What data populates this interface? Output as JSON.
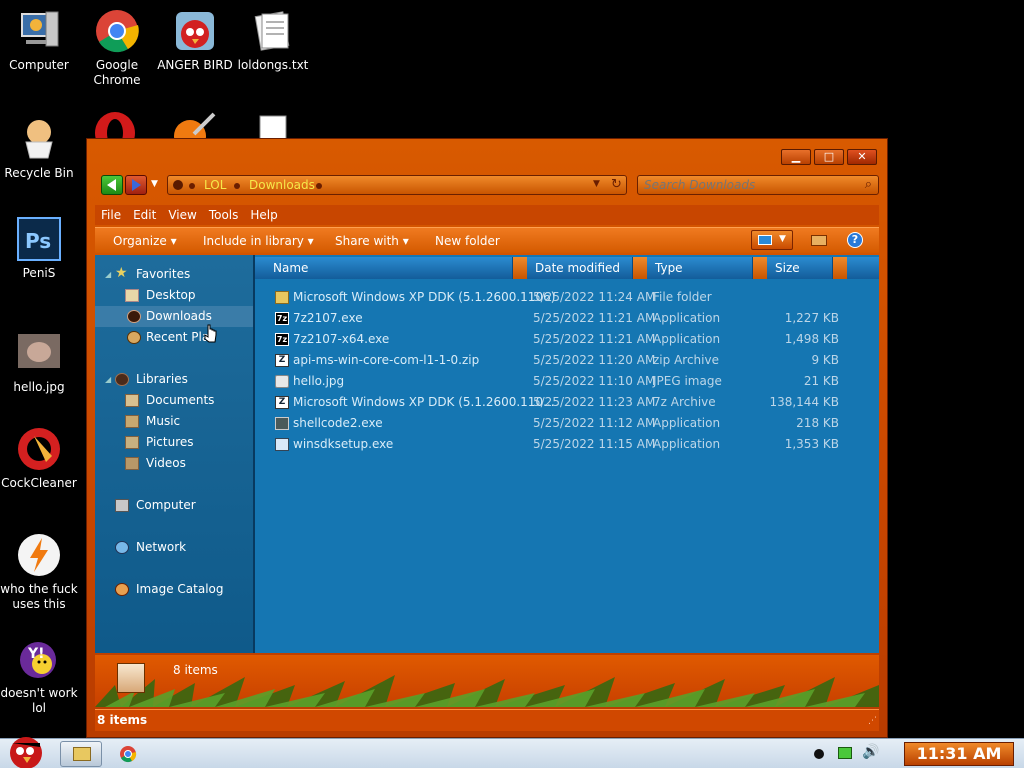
{
  "desktop": {
    "icons": [
      {
        "label": "Computer",
        "icon": "computer-icon"
      },
      {
        "label": "Google Chrome",
        "icon": "chrome-icon"
      },
      {
        "label": "ANGER BIRD",
        "icon": "angry-bird-icon"
      },
      {
        "label": "loldongs.txt",
        "icon": "text-file-icon"
      },
      {
        "label": "Recycle Bin",
        "icon": "recycle-bin-icon"
      },
      {
        "label": "PeniS",
        "icon": "photoshop-icon"
      },
      {
        "label": "hello.jpg",
        "icon": "image-file-icon"
      },
      {
        "label": "CockCleaner",
        "icon": "ccleaner-icon"
      },
      {
        "label": "who the fuck uses this",
        "icon": "winamp-icon"
      },
      {
        "label": "doesn't work lol",
        "icon": "yahoo-messenger-icon"
      }
    ]
  },
  "window": {
    "address": {
      "crumbs": [
        "LOL",
        "Downloads"
      ]
    },
    "search": {
      "placeholder": "Search Downloads"
    },
    "menubar": [
      "File",
      "Edit",
      "View",
      "Tools",
      "Help"
    ],
    "commands": {
      "organize": "Organize",
      "include": "Include in library",
      "share": "Share with",
      "new_folder": "New folder"
    },
    "nav": {
      "favorites": "Favorites",
      "desktop": "Desktop",
      "downloads": "Downloads",
      "recent": "Recent Pla",
      "libraries": "Libraries",
      "documents": "Documents",
      "music": "Music",
      "pictures": "Pictures",
      "videos": "Videos",
      "computer": "Computer",
      "network": "Network",
      "image_catalog": "Image Catalog"
    },
    "columns": {
      "name": "Name",
      "date": "Date modified",
      "type": "Type",
      "size": "Size"
    },
    "files": [
      {
        "name": "Microsoft Windows XP DDK (5.1.2600.1106)",
        "date": "5/25/2022 11:24 AM",
        "type": "File folder",
        "size": "",
        "icon": "folder-icon"
      },
      {
        "name": "7z2107.exe",
        "date": "5/25/2022 11:21 AM",
        "type": "Application",
        "size": "1,227 KB",
        "icon": "7zip-icon"
      },
      {
        "name": "7z2107-x64.exe",
        "date": "5/25/2022 11:21 AM",
        "type": "Application",
        "size": "1,498 KB",
        "icon": "7zip-icon"
      },
      {
        "name": "api-ms-win-core-com-l1-1-0.zip",
        "date": "5/25/2022 11:20 AM",
        "type": "zip Archive",
        "size": "9 KB",
        "icon": "zip-icon"
      },
      {
        "name": "hello.jpg",
        "date": "5/25/2022 11:10 AM",
        "type": "JPEG image",
        "size": "21 KB",
        "icon": "image-icon"
      },
      {
        "name": "Microsoft Windows XP DDK (5.1.2600.110...",
        "date": "5/25/2022 11:23 AM",
        "type": "7z Archive",
        "size": "138,144 KB",
        "icon": "archive-icon"
      },
      {
        "name": "shellcode2.exe",
        "date": "5/25/2022 11:12 AM",
        "type": "Application",
        "size": "218 KB",
        "icon": "exe-icon"
      },
      {
        "name": "winsdksetup.exe",
        "date": "5/25/2022 11:15 AM",
        "type": "Application",
        "size": "1,353 KB",
        "icon": "installer-icon"
      }
    ],
    "details_count": "8 items",
    "status_count": "8 items"
  },
  "taskbar": {
    "clock": "11:31 AM"
  },
  "colors": {
    "accent": "#d85a00",
    "content_bg": "#1576b2",
    "nav_bg": "#0f5a8a"
  }
}
